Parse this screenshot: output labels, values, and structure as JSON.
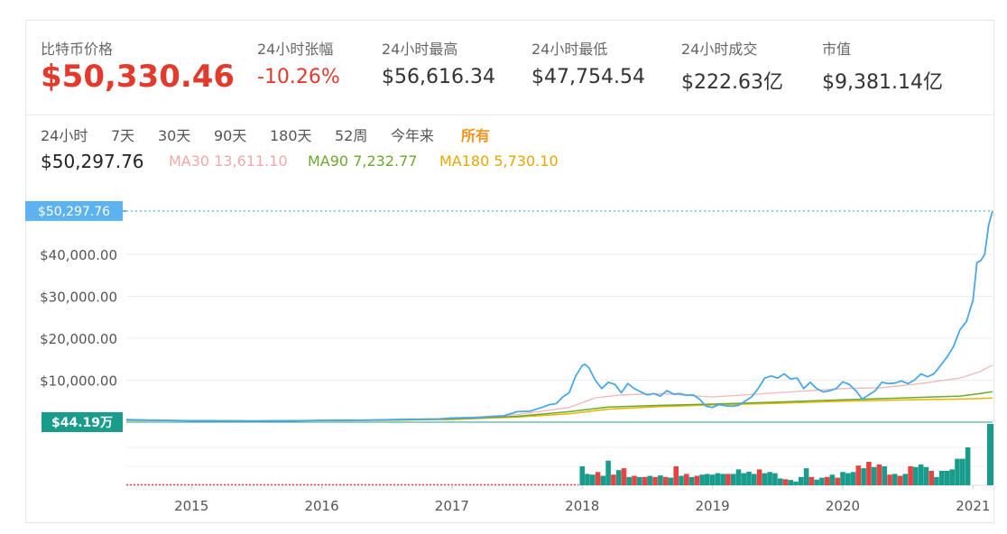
{
  "stats": {
    "price_label": "比特币价格",
    "price_value": "$50,330.46",
    "change_label": "24小时张幅",
    "change_value": "-10.26%",
    "high_label": "24小时最高",
    "high_value": "$56,616.34",
    "low_label": "24小时最低",
    "low_value": "$47,754.54",
    "volume_label": "24小时成交",
    "volume_value": "$222.63亿",
    "cap_label": "市值",
    "cap_value": "$9,381.14亿"
  },
  "tabs": [
    "24小时",
    "7天",
    "30天",
    "90天",
    "180天",
    "52周",
    "今年来",
    "所有"
  ],
  "active_tab": "所有",
  "legend": {
    "current_price": "$50,297.76",
    "ma30": "MA30 13,611.10",
    "ma90": "MA90 7,232.77",
    "ma180": "MA180 5,730.10"
  },
  "colors": {
    "price": "#4aa8e8",
    "ma30": "#f2b8b8",
    "ma90": "#6aaa2e",
    "ma180": "#e8b400",
    "vol_up": "#1a9c8c",
    "vol_down": "#e84343",
    "accent": "#f7931a"
  },
  "chart_data": {
    "type": "line",
    "x_ticks": [
      "2015",
      "2016",
      "2017",
      "2018",
      "2019",
      "2020",
      "2021"
    ],
    "y_ticks": [
      "$10,000.00",
      "$20,000.00",
      "$30,000.00",
      "$40,000.00"
    ],
    "ylim": [
      0,
      52000
    ],
    "xlim": [
      2014.5,
      2021.15
    ],
    "current_price_label": "$50,297.76",
    "current_price": 50297.76,
    "volume_label": "$44.19万",
    "series": [
      {
        "key": "price",
        "x": [
          2014.5,
          2014.8,
          2015.1,
          2015.4,
          2015.7,
          2016.0,
          2016.3,
          2016.6,
          2016.9,
          2017.0,
          2017.2,
          2017.3,
          2017.4,
          2017.5,
          2017.6,
          2017.7,
          2017.75,
          2017.8,
          2017.85,
          2017.9,
          2017.95,
          2018.0,
          2018.02,
          2018.05,
          2018.1,
          2018.15,
          2018.2,
          2018.25,
          2018.3,
          2018.35,
          2018.4,
          2018.45,
          2018.5,
          2018.55,
          2018.6,
          2018.65,
          2018.7,
          2018.75,
          2018.8,
          2018.85,
          2018.9,
          2018.95,
          2019.0,
          2019.05,
          2019.1,
          2019.15,
          2019.2,
          2019.25,
          2019.3,
          2019.35,
          2019.4,
          2019.45,
          2019.5,
          2019.55,
          2019.6,
          2019.65,
          2019.7,
          2019.75,
          2019.8,
          2019.85,
          2019.9,
          2019.95,
          2020.0,
          2020.05,
          2020.1,
          2020.15,
          2020.2,
          2020.25,
          2020.3,
          2020.35,
          2020.4,
          2020.45,
          2020.5,
          2020.55,
          2020.6,
          2020.65,
          2020.7,
          2020.75,
          2020.8,
          2020.85,
          2020.9,
          2020.95,
          2021.0,
          2021.03,
          2021.06,
          2021.09,
          2021.12,
          2021.15
        ],
        "y": [
          600,
          400,
          280,
          250,
          280,
          420,
          450,
          650,
          750,
          980,
          1100,
          1300,
          1500,
          2500,
          2600,
          3600,
          4200,
          4400,
          6000,
          7000,
          11000,
          13500,
          13800,
          13000,
          10000,
          8000,
          9500,
          9000,
          7000,
          9200,
          8000,
          7200,
          6500,
          6800,
          6200,
          7500,
          6700,
          6800,
          6400,
          6500,
          5500,
          3800,
          3500,
          4200,
          3900,
          3800,
          4000,
          5000,
          6000,
          8000,
          10500,
          11000,
          10500,
          11500,
          10300,
          10500,
          8000,
          9500,
          8000,
          7200,
          7500,
          8000,
          9600,
          9000,
          7500,
          5500,
          6500,
          7500,
          9500,
          9200,
          9300,
          9800,
          9200,
          10000,
          11500,
          10800,
          11500,
          13500,
          15500,
          18000,
          22000,
          24000,
          29000,
          38000,
          38500,
          40000,
          47000,
          50297.76
        ]
      },
      {
        "key": "ma30",
        "x": [
          2014.5,
          2015.5,
          2016.5,
          2017.0,
          2017.5,
          2017.9,
          2018.1,
          2018.3,
          2018.6,
          2019.0,
          2019.5,
          2020.0,
          2020.3,
          2020.6,
          2020.9,
          2021.05,
          2021.15
        ],
        "y": [
          450,
          300,
          550,
          900,
          1800,
          3500,
          5800,
          6500,
          6800,
          6000,
          7000,
          8000,
          8200,
          9200,
          10500,
          12000,
          13611.1
        ]
      },
      {
        "key": "ma90",
        "x": [
          2014.5,
          2015.5,
          2016.5,
          2017.0,
          2017.5,
          2017.9,
          2018.2,
          2018.6,
          2019.0,
          2019.5,
          2020.0,
          2020.5,
          2020.9,
          2021.05,
          2021.15
        ],
        "y": [
          450,
          300,
          500,
          750,
          1400,
          2500,
          3600,
          4000,
          4300,
          4800,
          5300,
          5800,
          6200,
          6800,
          7232.77
        ]
      },
      {
        "key": "ma180",
        "x": [
          2014.5,
          2015.5,
          2016.5,
          2017.0,
          2017.5,
          2017.9,
          2018.2,
          2018.6,
          2019.0,
          2019.5,
          2020.0,
          2020.5,
          2020.9,
          2021.05,
          2021.15
        ],
        "y": [
          450,
          300,
          450,
          650,
          1200,
          2000,
          3100,
          3700,
          4100,
          4500,
          5000,
          5300,
          5500,
          5600,
          5730.1
        ]
      }
    ],
    "volume_bars": [
      {
        "x": 2018.0,
        "v": 0.5,
        "c": "up"
      },
      {
        "x": 2018.04,
        "v": 0.3,
        "c": "up"
      },
      {
        "x": 2018.08,
        "v": 0.28,
        "c": "up"
      },
      {
        "x": 2018.12,
        "v": 0.35,
        "c": "down"
      },
      {
        "x": 2018.16,
        "v": 0.25,
        "c": "up"
      },
      {
        "x": 2018.2,
        "v": 0.65,
        "c": "up"
      },
      {
        "x": 2018.24,
        "v": 0.28,
        "c": "down"
      },
      {
        "x": 2018.28,
        "v": 0.4,
        "c": "up"
      },
      {
        "x": 2018.32,
        "v": 0.45,
        "c": "down"
      },
      {
        "x": 2018.36,
        "v": 0.22,
        "c": "up"
      },
      {
        "x": 2018.4,
        "v": 0.25,
        "c": "down"
      },
      {
        "x": 2018.44,
        "v": 0.22,
        "c": "up"
      },
      {
        "x": 2018.48,
        "v": 0.22,
        "c": "down"
      },
      {
        "x": 2018.52,
        "v": 0.25,
        "c": "up"
      },
      {
        "x": 2018.56,
        "v": 0.22,
        "c": "down"
      },
      {
        "x": 2018.6,
        "v": 0.26,
        "c": "up"
      },
      {
        "x": 2018.64,
        "v": 0.22,
        "c": "down"
      },
      {
        "x": 2018.68,
        "v": 0.2,
        "c": "up"
      },
      {
        "x": 2018.72,
        "v": 0.5,
        "c": "down"
      },
      {
        "x": 2018.76,
        "v": 0.25,
        "c": "up"
      },
      {
        "x": 2018.8,
        "v": 0.3,
        "c": "down"
      },
      {
        "x": 2018.84,
        "v": 0.22,
        "c": "up"
      },
      {
        "x": 2018.88,
        "v": 0.25,
        "c": "down"
      },
      {
        "x": 2018.92,
        "v": 0.28,
        "c": "up"
      },
      {
        "x": 2018.96,
        "v": 0.3,
        "c": "up"
      },
      {
        "x": 2019.0,
        "v": 0.28,
        "c": "up"
      },
      {
        "x": 2019.04,
        "v": 0.32,
        "c": "up"
      },
      {
        "x": 2019.08,
        "v": 0.3,
        "c": "up"
      },
      {
        "x": 2019.12,
        "v": 0.3,
        "c": "down"
      },
      {
        "x": 2019.16,
        "v": 0.3,
        "c": "up"
      },
      {
        "x": 2019.2,
        "v": 0.42,
        "c": "up"
      },
      {
        "x": 2019.24,
        "v": 0.32,
        "c": "up"
      },
      {
        "x": 2019.28,
        "v": 0.36,
        "c": "up"
      },
      {
        "x": 2019.32,
        "v": 0.3,
        "c": "up"
      },
      {
        "x": 2019.36,
        "v": 0.42,
        "c": "down"
      },
      {
        "x": 2019.4,
        "v": 0.32,
        "c": "up"
      },
      {
        "x": 2019.44,
        "v": 0.35,
        "c": "up"
      },
      {
        "x": 2019.48,
        "v": 0.32,
        "c": "up"
      },
      {
        "x": 2019.52,
        "v": 0.18,
        "c": "up"
      },
      {
        "x": 2019.56,
        "v": 0.16,
        "c": "down"
      },
      {
        "x": 2019.6,
        "v": 0.14,
        "c": "up"
      },
      {
        "x": 2019.64,
        "v": 0.1,
        "c": "up"
      },
      {
        "x": 2019.68,
        "v": 0.22,
        "c": "up"
      },
      {
        "x": 2019.72,
        "v": 0.45,
        "c": "up"
      },
      {
        "x": 2019.76,
        "v": 0.22,
        "c": "down"
      },
      {
        "x": 2019.8,
        "v": 0.15,
        "c": "up"
      },
      {
        "x": 2019.84,
        "v": 0.2,
        "c": "up"
      },
      {
        "x": 2019.88,
        "v": 0.22,
        "c": "down"
      },
      {
        "x": 2019.92,
        "v": 0.28,
        "c": "up"
      },
      {
        "x": 2019.96,
        "v": 0.2,
        "c": "down"
      },
      {
        "x": 2020.0,
        "v": 0.35,
        "c": "up"
      },
      {
        "x": 2020.04,
        "v": 0.32,
        "c": "up"
      },
      {
        "x": 2020.08,
        "v": 0.35,
        "c": "up"
      },
      {
        "x": 2020.12,
        "v": 0.52,
        "c": "down"
      },
      {
        "x": 2020.16,
        "v": 0.45,
        "c": "up"
      },
      {
        "x": 2020.2,
        "v": 0.62,
        "c": "down"
      },
      {
        "x": 2020.24,
        "v": 0.48,
        "c": "up"
      },
      {
        "x": 2020.28,
        "v": 0.55,
        "c": "down"
      },
      {
        "x": 2020.32,
        "v": 0.5,
        "c": "up"
      },
      {
        "x": 2020.36,
        "v": 0.28,
        "c": "down"
      },
      {
        "x": 2020.4,
        "v": 0.3,
        "c": "up"
      },
      {
        "x": 2020.44,
        "v": 0.25,
        "c": "down"
      },
      {
        "x": 2020.48,
        "v": 0.3,
        "c": "up"
      },
      {
        "x": 2020.52,
        "v": 0.5,
        "c": "down"
      },
      {
        "x": 2020.56,
        "v": 0.48,
        "c": "up"
      },
      {
        "x": 2020.6,
        "v": 0.55,
        "c": "up"
      },
      {
        "x": 2020.64,
        "v": 0.48,
        "c": "up"
      },
      {
        "x": 2020.68,
        "v": 0.38,
        "c": "down"
      },
      {
        "x": 2020.72,
        "v": 0.22,
        "c": "up"
      },
      {
        "x": 2020.76,
        "v": 0.38,
        "c": "up"
      },
      {
        "x": 2020.8,
        "v": 0.38,
        "c": "up"
      },
      {
        "x": 2020.84,
        "v": 0.42,
        "c": "up"
      },
      {
        "x": 2020.88,
        "v": 0.7,
        "c": "up"
      },
      {
        "x": 2020.92,
        "v": 0.7,
        "c": "up"
      },
      {
        "x": 2020.96,
        "v": 1.0,
        "c": "up"
      }
    ]
  }
}
